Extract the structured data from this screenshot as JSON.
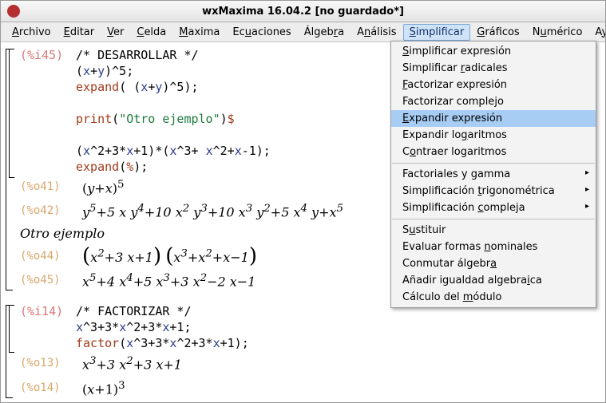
{
  "title": "wxMaxima 16.04.2 [no guardado*]",
  "menu": {
    "archivo": "Archivo",
    "editar": "Editar",
    "ver": "Ver",
    "celda": "Celda",
    "maxima": "Maxima",
    "ecuaciones": "Ecuaciones",
    "algebra": "Álgebra",
    "analisis": "Análisis",
    "simplificar": "Simplificar",
    "graficos": "Gráficos",
    "numerico": "Numérico",
    "ayuda": "Ayuda"
  },
  "dropdown": {
    "simpl_expr": "Simplificar expresión",
    "simpl_rad": "Simplificar radicales",
    "fact_expr": "Factorizar expresión",
    "fact_comp": "Factorizar complejo",
    "exp_expr": "Expandir expresión",
    "exp_log": "Expandir logaritmos",
    "con_log": "Contraer logaritmos",
    "fact_gamma": "Factoriales y gamma",
    "simpl_trig": "Simplificación trigonométrica",
    "simpl_comp": "Simplificación compleja",
    "sust": "Sustituir",
    "eval_nom": "Evaluar formas nominales",
    "conm": "Conmutar álgebra",
    "anadir": "Añadir igualdad algebraica",
    "modulo": "Cálculo del módulo"
  },
  "cell1": {
    "label_in": "(%i45)",
    "comment": "/* DESARROLLAR */",
    "l2_a": "(",
    "l2_b": "x",
    "l2_c": "+",
    "l2_d": "y",
    "l2_e": ")^5;",
    "l3_a": "expand",
    "l3_b": "( ",
    "l3_c": "(",
    "l3_d": "x",
    "l3_e": "+",
    "l3_f": "y",
    "l3_g": ")^5)",
    "l3_h": ";",
    "l5_a": "print",
    "l5_b": "(",
    "l5_c": "\"Otro ejemplo\"",
    "l5_d": ")",
    "l5_e": "$",
    "l7_a": "(",
    "l7_b": "x",
    "l7_c": "^2+3*",
    "l7_d": "x",
    "l7_e": "+1)*(",
    "l7_f": "x",
    "l7_g": "^3+ ",
    "l7_h": "x",
    "l7_i": "^2+",
    "l7_j": "x",
    "l7_k": "-1);",
    "l8_a": "expand",
    "l8_b": "(",
    "l8_c": "%",
    "l8_d": ")",
    "l8_e": ";",
    "o41_lbl": "(%o41)",
    "o41": "(y+x)",
    "o41_exp": "5",
    "o42_lbl": "(%o42)",
    "o42_body": "y<sup>5</sup>+5 x y<sup>4</sup>+10 x<sup>2</sup> y<sup>3</sup>+10 x<sup>3</sup> y<sup>2</sup>+5 x<sup>4</sup> y+x<sup>5</sup>",
    "otro": "Otro ejemplo",
    "o44_lbl": "(%o44)",
    "o44_a": "x<sup>2</sup>+3 x+1",
    "o44_b": "x<sup>3</sup>+x<sup>2</sup>+x−1",
    "o45_lbl": "(%o45)",
    "o45": "x<sup>5</sup>+4 x<sup>4</sup>+5 x<sup>3</sup>+3 x<sup>2</sup>−2 x−1"
  },
  "cell2": {
    "label_in": "(%i14)",
    "comment": "/* FACTORIZAR */",
    "l2_a": "x",
    "l2_b": "^3+3*",
    "l2_c": "x",
    "l2_d": "^2+3*",
    "l2_e": "x",
    "l2_f": "+1;",
    "l3_a": "factor",
    "l3_b": "(",
    "l3_c": "x",
    "l3_d": "^3+3*",
    "l3_e": "x",
    "l3_f": "^2+3*",
    "l3_g": "x",
    "l3_h": "+1)",
    "l3_i": ";",
    "o13_lbl": "(%o13)",
    "o13": "x<sup>3</sup>+3 x<sup>2</sup>+3 x+1",
    "o14_lbl": "(%o14)",
    "o14_base": "(x+1)",
    "o14_exp": "3"
  }
}
